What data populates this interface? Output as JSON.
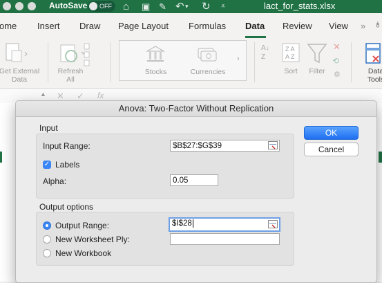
{
  "titlebar": {
    "autosave_label": "AutoSave",
    "autosave_state": "OFF",
    "filename": "lact_for_stats.xlsx",
    "icons": [
      "home-icon",
      "save-icon",
      "edit-icon",
      "undo-icon",
      "redo-icon",
      "customize-icon"
    ]
  },
  "tabs": [
    "ome",
    "Insert",
    "Draw",
    "Page Layout",
    "Formulas",
    "Data",
    "Review",
    "View"
  ],
  "active_tab": "Data",
  "ribbon": {
    "get_external_data": "Get External\nData",
    "refresh_all": "Refresh\nAll",
    "stocks": "Stocks",
    "currencies": "Currencies",
    "sort": "Sort",
    "filter": "Filter",
    "data_tools": "Data\nTools"
  },
  "dialog": {
    "title": "Anova: Two-Factor Without Replication",
    "input_group": "Input",
    "input_range_label": "Input Range:",
    "input_range_value": "$B$27:$G$39",
    "labels_label": "Labels",
    "labels_checked": true,
    "alpha_label": "Alpha:",
    "alpha_value": "0.05",
    "output_group": "Output options",
    "output_range_label": "Output Range:",
    "output_range_value": "$I$28",
    "new_worksheet_label": "New Worksheet Ply:",
    "new_worksheet_value": "",
    "new_workbook_label": "New Workbook",
    "selected_output": "output-range",
    "ok_label": "OK",
    "cancel_label": "Cancel"
  },
  "colors": {
    "excel_green": "#207245",
    "accent_blue": "#3b86f6"
  }
}
